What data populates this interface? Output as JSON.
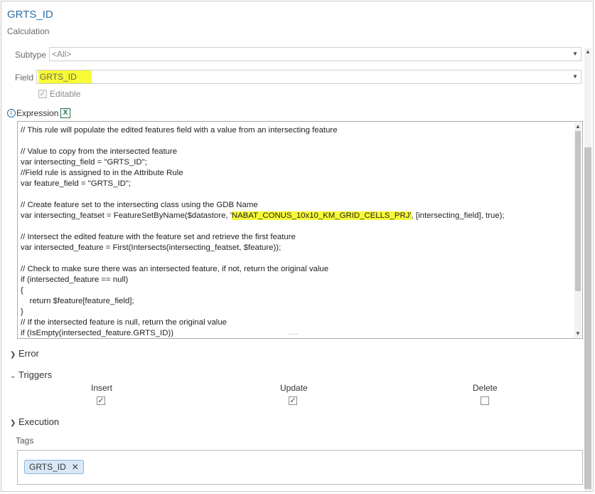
{
  "header": {
    "title": "GRTS_ID",
    "subtitle": "Calculation"
  },
  "subtype": {
    "label": "Subtype",
    "value": "<All>"
  },
  "field": {
    "label": "Field",
    "value": "GRTS_ID",
    "highlight_color": "#f7fa35"
  },
  "editable": {
    "label": "Editable",
    "checked": true
  },
  "expression": {
    "label": "Expression",
    "code_lines": [
      "// This rule will populate the edited features field with a value from an intersecting feature",
      "",
      "// Value to copy from the intersected feature",
      "var intersecting_field = \"GRTS_ID\";",
      "//Field rule is assigned to in the Attribute Rule",
      "var feature_field = \"GRTS_ID\";",
      "",
      "// Create feature set to the intersecting class using the GDB Name",
      {
        "pre": "var intersecting_featset = FeatureSetByName($datastore, '",
        "hl": "NABAT_CONUS_10x10_KM_GRID_CELLS_PRJ'",
        "post": ", [intersecting_field], true);"
      },
      "",
      "// Intersect the edited feature with the feature set and retrieve the first feature",
      "var intersected_feature = First(Intersects(intersecting_featset, $feature));",
      "",
      "// Check to make sure there was an intersected feature, if not, return the original value",
      "if (intersected_feature == null)",
      "{",
      "    return $feature[feature_field];",
      "}",
      "// If the intersected feature is null, return the original value",
      "if (IsEmpty(intersected_feature.GRTS_ID))"
    ],
    "grip": "....",
    "icons": [
      "info-icon",
      "excel-icon"
    ]
  },
  "sections": {
    "error": "Error",
    "triggers": "Triggers",
    "execution": "Execution"
  },
  "triggers": [
    {
      "label": "Insert",
      "checked": true
    },
    {
      "label": "Update",
      "checked": true
    },
    {
      "label": "Delete",
      "checked": false
    }
  ],
  "tags": {
    "label": "Tags",
    "chips": [
      {
        "label": "GRTS_ID"
      }
    ]
  },
  "colors": {
    "title": "#2b6ea8",
    "highlight": "#f7fa35",
    "chip_bg": "#d8e8f7"
  }
}
